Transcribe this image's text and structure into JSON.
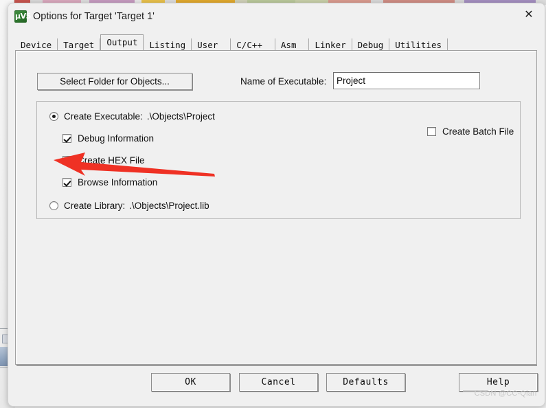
{
  "window": {
    "title": "Options for Target 'Target 1'",
    "app_icon": "keil-uvision-icon",
    "app_icon_glyph": "µV5",
    "close_glyph": "✕"
  },
  "tabs": [
    {
      "label": "Device",
      "selected": false
    },
    {
      "label": "Target",
      "selected": false
    },
    {
      "label": "Output",
      "selected": true
    },
    {
      "label": "Listing",
      "selected": false
    },
    {
      "label": "User",
      "selected": false
    },
    {
      "label": "C/C++",
      "selected": false
    },
    {
      "label": "Asm",
      "selected": false
    },
    {
      "label": "Linker",
      "selected": false
    },
    {
      "label": "Debug",
      "selected": false
    },
    {
      "label": "Utilities",
      "selected": false
    }
  ],
  "output_page": {
    "select_folder_button": "Select Folder for Objects...",
    "executable_label": "Name of Executable:",
    "executable_value": "Project",
    "executable_placeholder": "Project",
    "create_executable": {
      "label": "Create Executable:",
      "path": ".\\Objects\\Project",
      "selected": true
    },
    "create_library": {
      "label": "Create Library:",
      "path": ".\\Objects\\Project.lib",
      "selected": false
    },
    "checkboxes": [
      {
        "label": "Debug Information",
        "checked": true
      },
      {
        "label": "Create HEX File",
        "checked": true
      },
      {
        "label": "Browse Information",
        "checked": true
      }
    ],
    "batch_file": {
      "label": "Create Batch File",
      "checked": false
    }
  },
  "footer": {
    "ok": "OK",
    "cancel": "Cancel",
    "defaults": "Defaults",
    "help": "Help"
  },
  "annotation": {
    "arrow_color": "#ef3124",
    "target": "Create HEX File"
  },
  "watermark": "CSDN @CC-Qian"
}
